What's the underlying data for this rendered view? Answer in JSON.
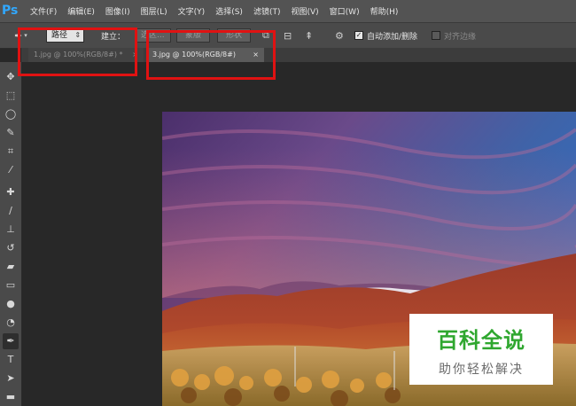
{
  "app": {
    "logo": "Ps"
  },
  "menu": [
    "文件(F)",
    "编辑(E)",
    "图像(I)",
    "图层(L)",
    "文字(Y)",
    "选择(S)",
    "滤镜(T)",
    "视图(V)",
    "窗口(W)",
    "帮助(H)"
  ],
  "options": {
    "mode_value": "路径",
    "make_label": "建立：",
    "selection_btn": "选区...",
    "mask_btn": "蒙版",
    "shape_btn": "形状",
    "auto_add_delete": {
      "label": "自动添加/删除",
      "checked": true
    },
    "align_edges": {
      "label": "对齐边缘",
      "checked": false
    }
  },
  "tabs": [
    {
      "label": "1.jpg @ 100%(RGB/8#) *",
      "close": "×",
      "active": false
    },
    {
      "label": "3.jpg @ 100%(RGB/8#)",
      "close": "×",
      "active": true
    }
  ],
  "tools": [
    "move-tool",
    "marquee-tool",
    "lasso-tool",
    "quick-select-tool",
    "crop-tool",
    "eyedropper-tool",
    "healing-brush-tool",
    "brush-tool",
    "stamp-tool",
    "history-brush-tool",
    "eraser-tool",
    "gradient-tool",
    "blur-tool",
    "dodge-tool",
    "pen-tool",
    "type-tool",
    "path-select-tool",
    "rectangle-tool"
  ],
  "watermark": {
    "main": "百科全说",
    "sub": "助你轻松解决"
  },
  "colors": {
    "accent_red": "#e01212",
    "watermark_green": "#2fa72f",
    "ps_blue": "#31a8ff"
  }
}
